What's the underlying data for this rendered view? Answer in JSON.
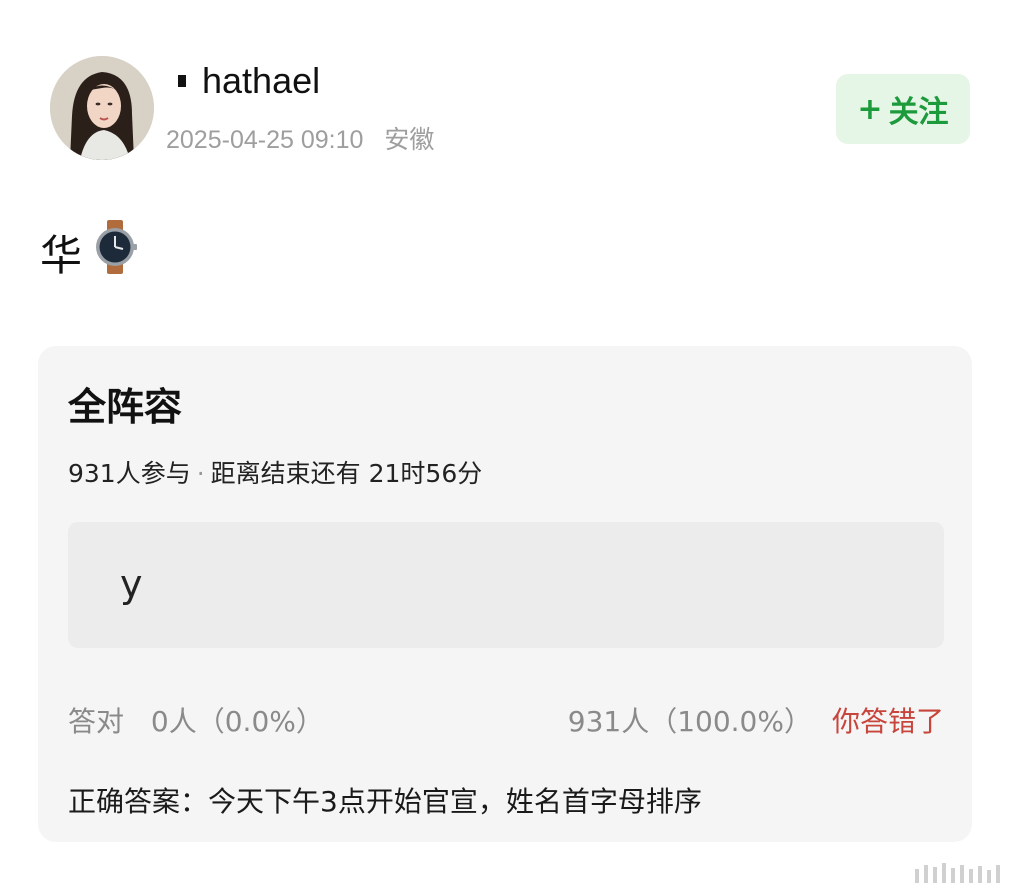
{
  "header": {
    "username": "hathael",
    "timestamp": "2025-04-25 09:10",
    "location": "安徽",
    "follow_label": "关注",
    "follow_plus": "+"
  },
  "post": {
    "text": "华",
    "emoji_icon": "wristwatch-icon"
  },
  "quiz": {
    "title": "全阵容",
    "participants": "931人参与",
    "separator": "·",
    "time_left": "距离结束还有 21时56分",
    "option_text": "y",
    "correct_label": "答对",
    "correct_count": "0人（0.0%）",
    "wrong_count": "931人（100.0%）",
    "wrong_label": "你答错了",
    "answer": "正确答案：今天下午3点开始官宣，姓名首字母排序"
  },
  "colors": {
    "follow_green": "#1d9a3b",
    "follow_bg": "#e6f6e6",
    "wrong_red": "#c8453c",
    "card_bg": "#f5f5f5"
  }
}
